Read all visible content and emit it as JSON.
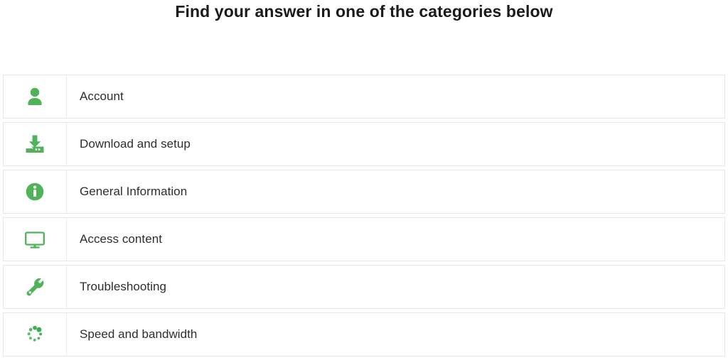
{
  "header": {
    "title": "Find your answer in one of the categories below"
  },
  "theme": {
    "icon_green": "#4fb35a",
    "row_border": "#e7e7e7",
    "divider": "#ececec",
    "text_color": "#2e2e2e",
    "title_color": "#1b1b1b",
    "background": "#ffffff"
  },
  "categories": [
    {
      "label": "Account",
      "icon": "person-icon"
    },
    {
      "label": "Download and setup",
      "icon": "download-icon"
    },
    {
      "label": "General Information",
      "icon": "info-circle-icon"
    },
    {
      "label": "Access content",
      "icon": "monitor-icon"
    },
    {
      "label": "Troubleshooting",
      "icon": "wrench-icon"
    },
    {
      "label": "Speed and bandwidth",
      "icon": "spinner-dots-icon"
    }
  ]
}
